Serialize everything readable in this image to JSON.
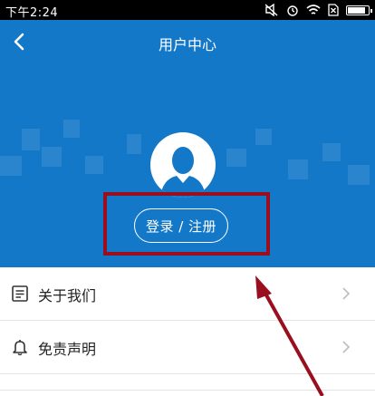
{
  "status_bar": {
    "time": "下午2:24"
  },
  "header": {
    "title": "用户中心",
    "login_label": "登录 / 注册"
  },
  "menu": {
    "items": [
      {
        "label": "关于我们",
        "icon": "document-list-icon"
      },
      {
        "label": "免责声明",
        "icon": "bell-icon"
      }
    ]
  },
  "colors": {
    "header_blue": "#1478c9",
    "annotation_red": "#9a0f1f",
    "battery_fill": "#ffffff"
  }
}
